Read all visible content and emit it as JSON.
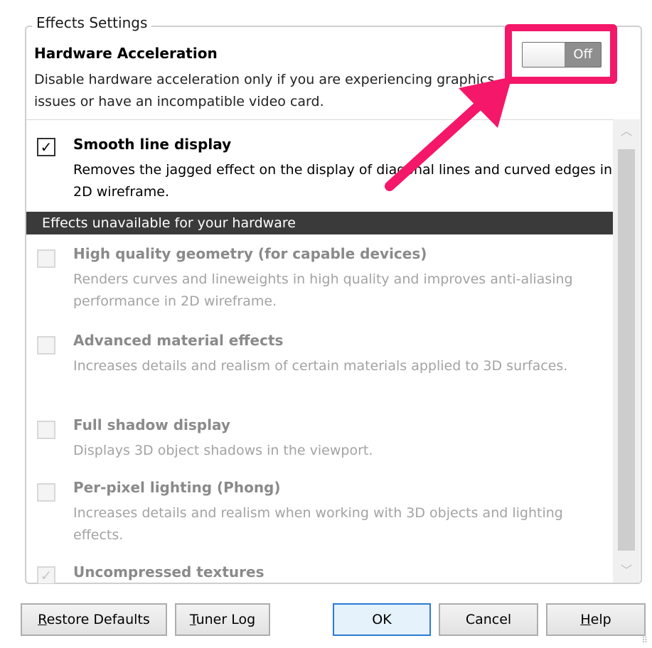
{
  "group": {
    "legend": "Effects Settings",
    "hw_title": "Hardware Acceleration",
    "hw_desc": "Disable hardware acceleration only if you are experiencing graphics issues or have an incompatible video card.",
    "toggle_state": "Off"
  },
  "list": {
    "smooth": {
      "checked": true,
      "title": "Smooth line display",
      "desc": "Removes the jagged effect on the display of diagonal lines and curved edges in 2D wireframe."
    },
    "section_header": "Effects unavailable for your hardware",
    "items": [
      {
        "title": "High quality geometry (for capable devices)",
        "desc": "Renders curves and lineweights in high quality and improves anti-aliasing performance in 2D wireframe.",
        "checked": false
      },
      {
        "title": "Advanced material effects",
        "desc": "Increases details and realism of certain materials applied to 3D surfaces.",
        "checked": false
      },
      {
        "title": "Full shadow display",
        "desc": "Displays 3D object shadows in the viewport.",
        "checked": false
      },
      {
        "title": "Per-pixel lighting (Phong)",
        "desc": "Increases details and realism when working with 3D objects and lighting effects.",
        "checked": false
      },
      {
        "title": "Uncompressed textures",
        "desc": "",
        "checked": true
      }
    ]
  },
  "buttons": {
    "restore_m": "R",
    "restore_rest": "estore Defaults",
    "tuner_m": "T",
    "tuner_rest": "uner Log",
    "ok": "OK",
    "cancel": "Cancel",
    "help_m": "H",
    "help_rest": "elp"
  },
  "colors": {
    "highlight": "#f4176a",
    "section_bar": "#3a3a3a"
  }
}
